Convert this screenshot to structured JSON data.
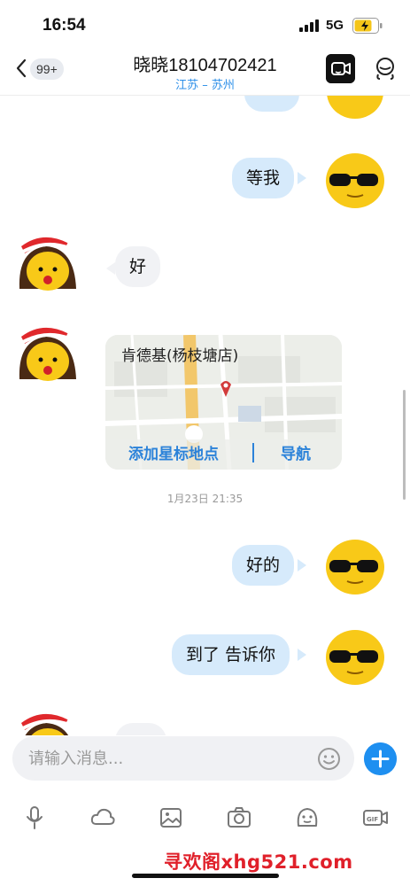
{
  "status_bar": {
    "time": "16:54",
    "network": "5G"
  },
  "header": {
    "unread_count": "99+",
    "contact_name": "晓晓18104702421",
    "contact_location": "江苏 – 苏州"
  },
  "messages": [
    {
      "from": "me",
      "text": "等我"
    },
    {
      "from": "them",
      "text": "好"
    },
    {
      "from": "them",
      "type": "location",
      "place": "肯德基(杨枝塘店)",
      "action_star": "添加星标地点",
      "action_nav": "导航"
    },
    {
      "type": "timestamp",
      "text": "1月23日 21:35"
    },
    {
      "from": "me",
      "text": "好的"
    },
    {
      "from": "me",
      "text": "到了 告诉你"
    }
  ],
  "input": {
    "placeholder": "请输入消息..."
  },
  "toolbar": {
    "items": [
      "mic-icon",
      "cloud-icon",
      "image-icon",
      "camera-icon",
      "sticker-icon",
      "gif-icon"
    ]
  },
  "watermark": "寻欢阁xhg521.com",
  "colors": {
    "accent": "#1e8ff0",
    "bubble_out": "#d6eafb",
    "bubble_in": "#f1f2f5",
    "watermark": "#e0202a"
  }
}
